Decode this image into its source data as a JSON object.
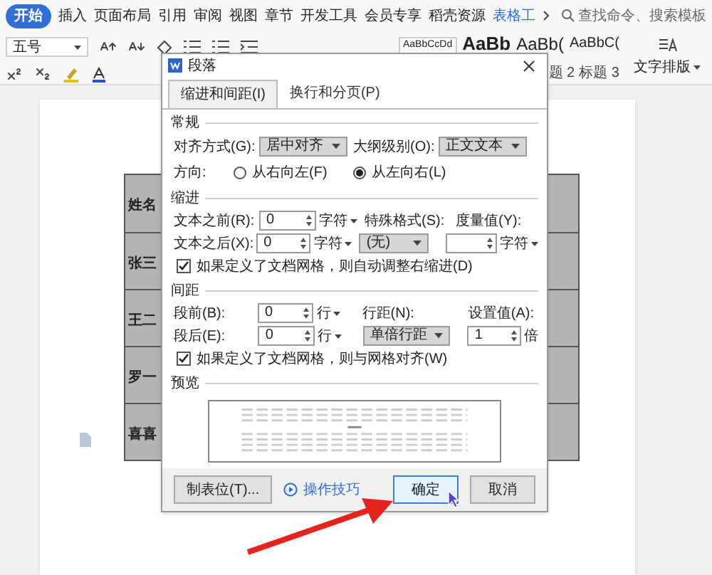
{
  "ribbon_tabs": [
    {
      "label": "开始",
      "selected": true
    },
    {
      "label": "插入",
      "selected": false
    },
    {
      "label": "页面布局",
      "selected": false
    },
    {
      "label": "引用",
      "selected": false
    },
    {
      "label": "审阅",
      "selected": false
    },
    {
      "label": "视图",
      "selected": false
    },
    {
      "label": "章节",
      "selected": false
    },
    {
      "label": "开发工具",
      "selected": false
    },
    {
      "label": "会员专享",
      "selected": false
    },
    {
      "label": "稻壳资源",
      "selected": false
    },
    {
      "label": "表格工",
      "selected": false
    }
  ],
  "search": {
    "placeholder": "查找命令、搜索模板"
  },
  "toolbar": {
    "font_size": "五号",
    "styles": [
      {
        "sample": "AaBbCcDd"
      },
      {
        "sample": "AaBb"
      },
      {
        "sample": "AaBb(",
        "label": "题 2"
      },
      {
        "sample": "AaBbC(",
        "label": "标题 3"
      }
    ],
    "text_layout": "文字排版"
  },
  "table": {
    "rows": [
      "姓名",
      "张三",
      "王二",
      "罗一",
      "喜喜"
    ]
  },
  "dialog": {
    "title": "段落",
    "tabs": [
      {
        "label": "缩进和间距(I)",
        "selected": true
      },
      {
        "label": "换行和分页(P)",
        "selected": false
      }
    ],
    "general": {
      "heading": "常规",
      "alignment_label": "对齐方式(G):",
      "alignment": "居中对齐",
      "outline_label": "大纲级别(O):",
      "outline": "正文文本",
      "direction_label": "方向:",
      "directions": [
        {
          "label": "从右向左(F)",
          "selected": false
        },
        {
          "label": "从左向右(L)",
          "selected": true
        }
      ]
    },
    "indent": {
      "heading": "缩进",
      "before_label": "文本之前(R):",
      "before": "0",
      "before_unit": "字符",
      "special_label": "特殊格式(S):",
      "measure_label": "度量值(Y):",
      "after_label": "文本之后(X):",
      "after": "0",
      "after_unit": "字符",
      "special": "(无)",
      "measure_unit": "字符",
      "auto_adjust": {
        "label": "如果定义了文档网格，则自动调整右缩进(D)",
        "checked": true
      }
    },
    "spacing": {
      "heading": "间距",
      "before_label": "段前(B):",
      "before": "0",
      "before_unit": "行",
      "line_label": "行距(N):",
      "value_label": "设置值(A):",
      "after_label": "段后(E):",
      "after": "0",
      "after_unit": "行",
      "line": "单倍行距",
      "value": "1",
      "value_unit": "倍",
      "snap": {
        "label": "如果定义了文档网格，则与网格对齐(W)",
        "checked": true
      }
    },
    "preview_heading": "预览",
    "buttons": {
      "tabs": "制表位(T)...",
      "tips": "操作技巧",
      "ok": "确定",
      "cancel": "取消"
    }
  }
}
